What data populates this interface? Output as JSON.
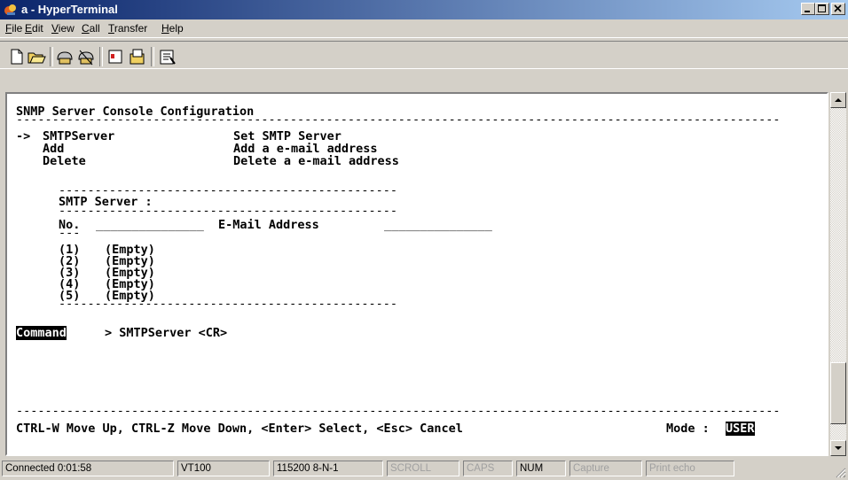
{
  "window": {
    "title": "a - HyperTerminal",
    "app_icon": "hyperterminal-icon",
    "controls": [
      "minimize-icon",
      "maximize-icon",
      "close-icon"
    ]
  },
  "menu": {
    "items": [
      {
        "label": "File",
        "accel": "F"
      },
      {
        "label": "Edit",
        "accel": "E"
      },
      {
        "label": "View",
        "accel": "V"
      },
      {
        "label": "Call",
        "accel": "C"
      },
      {
        "label": "Transfer",
        "accel": "T"
      },
      {
        "label": "Help",
        "accel": "H"
      }
    ]
  },
  "toolbar": {
    "buttons": [
      "new-icon",
      "open-icon",
      "connect-icon",
      "disconnect-icon",
      "send-icon",
      "receive-icon",
      "properties-icon"
    ]
  },
  "terminal": {
    "header": "SNMP Server Console Configuration",
    "separator_full": "----------------------------------------------------------------------------------------------------------",
    "menu_rows": [
      {
        "pointer": "->",
        "command": "SMTPServer",
        "description": "Set SMTP Server"
      },
      {
        "pointer": "",
        "command": "Add",
        "description": "Add a e-mail address"
      },
      {
        "pointer": "",
        "command": "Delete",
        "description": "Delete a e-mail address"
      }
    ],
    "separator_short": "-----------------------------------------------",
    "smtp_server_label": "SMTP Server :",
    "col_no": "No.",
    "col_no_underline": "---",
    "col_email": "E-Mail Address",
    "col_email_prefix": "_______________",
    "col_email_suffix": "_______________",
    "entries": [
      {
        "no": "(1)",
        "value": "(Empty)"
      },
      {
        "no": "(2)",
        "value": "(Empty)"
      },
      {
        "no": "(3)",
        "value": "(Empty)"
      },
      {
        "no": "(4)",
        "value": "(Empty)"
      },
      {
        "no": "(5)",
        "value": "(Empty)"
      }
    ],
    "command_label": "Command",
    "command_prompt": "> SMTPServer <CR>",
    "footer_help": "CTRL-W Move Up, CTRL-Z Move Down, <Enter> Select, <Esc> Cancel",
    "mode_label": "Mode :",
    "mode_value": "USER"
  },
  "status": {
    "connected": "Connected 0:01:58",
    "emulation": "VT100",
    "settings": "115200 8-N-1",
    "scroll": "SCROLL",
    "caps": "CAPS",
    "num": "NUM",
    "capture": "Capture",
    "print_echo": "Print echo"
  }
}
